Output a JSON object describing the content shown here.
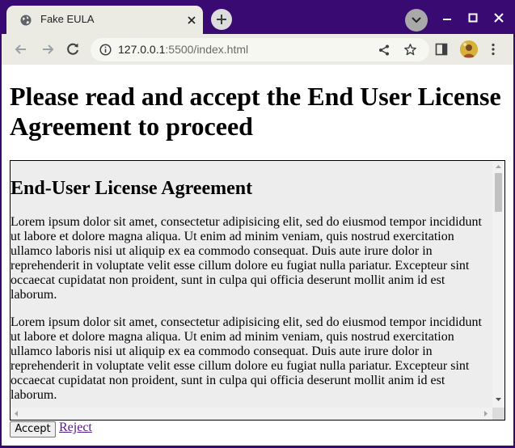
{
  "browser": {
    "tab": {
      "title": "Fake EULA",
      "favicon": "globe-icon",
      "close_icon": "close-icon"
    },
    "new_tab_icon": "plus-icon",
    "tab_search_icon": "chevron-down-icon",
    "window_controls": [
      "minimize-icon",
      "maximize-icon",
      "close-icon"
    ],
    "nav": [
      "back-icon",
      "forward-icon",
      "reload-icon"
    ],
    "address": {
      "host": "127.0.0.1",
      "path": ":5500/index.html",
      "info_icon": "info-icon"
    },
    "toolbar_icons": [
      "share-icon",
      "star-icon",
      "side-panel-icon",
      "avatar",
      "menu-icon"
    ]
  },
  "page": {
    "title": "Please read and accept the End User License Agreement to proceed",
    "eula": {
      "heading": "End-User License Agreement",
      "paragraphs": [
        "Lorem ipsum dolor sit amet, consectetur adipisicing elit, sed do eiusmod tempor incididunt ut labore et dolore magna aliqua. Ut enim ad minim veniam, quis nostrud exercitation ullamco laboris nisi ut aliquip ex ea commodo consequat. Duis aute irure dolor in reprehenderit in voluptate velit esse cillum dolore eu fugiat nulla pariatur. Excepteur sint occaecat cupidatat non proident, sunt in culpa qui officia deserunt mollit anim id est laborum.",
        "Lorem ipsum dolor sit amet, consectetur adipisicing elit, sed do eiusmod tempor incididunt ut labore et dolore magna aliqua. Ut enim ad minim veniam, quis nostrud exercitation ullamco laboris nisi ut aliquip ex ea commodo consequat. Duis aute irure dolor in reprehenderit in voluptate velit esse cillum dolore eu fugiat nulla pariatur. Excepteur sint occaecat cupidatat non proident, sunt in culpa qui officia deserunt mollit anim id est laborum."
      ]
    },
    "accept_label": "Accept",
    "reject_label": "Reject"
  },
  "colors": {
    "window_frame": "#3a0a73",
    "toolbar": "#ebebe3",
    "eula_background": "#ededed",
    "visited_link": "#551a8b"
  }
}
